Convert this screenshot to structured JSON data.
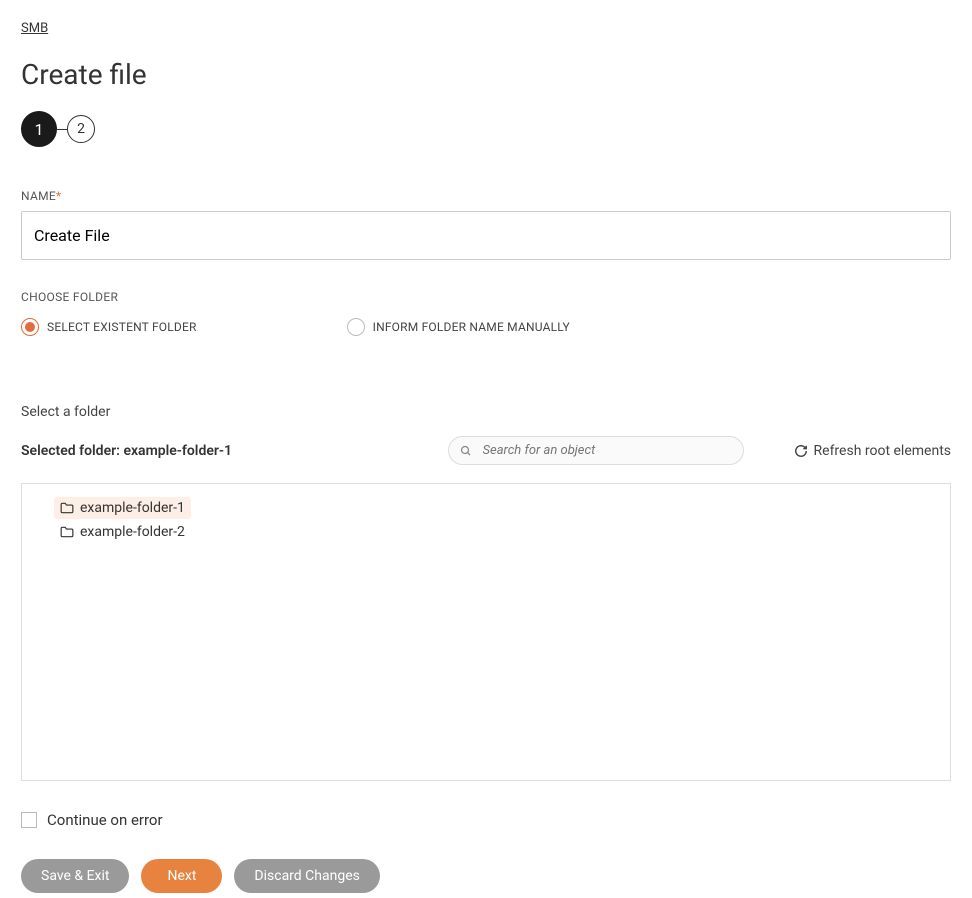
{
  "breadcrumb": "SMB",
  "page_title": "Create file",
  "stepper": {
    "step1": "1",
    "step2": "2"
  },
  "name_field": {
    "label": "NAME",
    "value": "Create File"
  },
  "choose_folder": {
    "label": "CHOOSE FOLDER",
    "options": {
      "select_existent": "SELECT EXISTENT FOLDER",
      "inform_manually": "INFORM FOLDER NAME MANUALLY"
    }
  },
  "folder_section": {
    "title": "Select a folder",
    "selected_prefix": "Selected folder: ",
    "selected_value": "example-folder-1",
    "search_placeholder": "Search for an object",
    "refresh_label": "Refresh root elements"
  },
  "tree": {
    "items": [
      {
        "label": "example-folder-1",
        "selected": true
      },
      {
        "label": "example-folder-2",
        "selected": false
      }
    ]
  },
  "continue_on_error": "Continue on error",
  "buttons": {
    "save_exit": "Save & Exit",
    "next": "Next",
    "discard": "Discard Changes"
  }
}
